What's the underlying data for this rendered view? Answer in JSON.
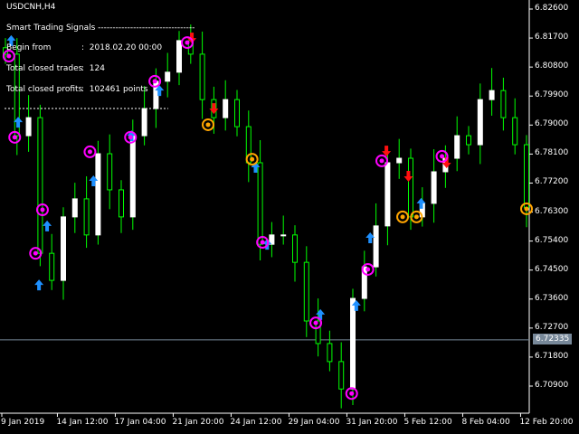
{
  "symbol_label": "USDCNH,H4",
  "panel": {
    "title": "Smart Trading Signals ---------------------------------",
    "rows": [
      {
        "label": "Begin from",
        "value": "2018.02.20 00:00"
      },
      {
        "label": "Total closed trades",
        "value": "124"
      },
      {
        "label": "Total closed profits",
        "value": "102461 points"
      }
    ]
  },
  "colors": {
    "wick": "#00ff00",
    "bull": "#ffffff",
    "bear": "#000000",
    "up_arrow": "#1e90ff",
    "down_arrow": "#ff1010",
    "open_circle": "#ff00ff",
    "close_circle": "#ffa500",
    "grid": "#ffffff",
    "current_line": "#778899"
  },
  "chart_data": {
    "type": "candlestick",
    "title": "USDCNH,H4",
    "ylim": [
      6.709,
      6.826
    ],
    "y_ticks": [
      "6.82600",
      "6.81700",
      "6.80800",
      "6.79900",
      "6.79000",
      "6.78100",
      "6.77200",
      "6.76300",
      "6.75400",
      "6.74500",
      "6.73600",
      "6.72700",
      "6.71800",
      "6.70900"
    ],
    "x_ticks": [
      {
        "label": "9 Jan 2019",
        "i": 0
      },
      {
        "label": "14 Jan 12:00",
        "i": 4.8
      },
      {
        "label": "17 Jan 04:00",
        "i": 9.8
      },
      {
        "label": "21 Jan 20:00",
        "i": 14.8
      },
      {
        "label": "24 Jan 12:00",
        "i": 19.8
      },
      {
        "label": "29 Jan 04:00",
        "i": 24.8
      },
      {
        "label": "31 Jan 20:00",
        "i": 29.8
      },
      {
        "label": "5 Feb 12:00",
        "i": 34.8
      },
      {
        "label": "8 Feb 04:00",
        "i": 39.8
      },
      {
        "label": "12 Feb 20:00",
        "i": 44.8
      }
    ],
    "current_price": "6.72335",
    "current_price_value": 6.72335,
    "closes": [
      6.812,
      6.7867,
      6.7923,
      6.7502,
      6.7418,
      6.7615,
      6.7671,
      6.7559,
      6.7811,
      6.7699,
      6.7615,
      6.7867,
      6.7951,
      6.8036,
      6.8064,
      6.8162,
      6.812,
      6.7979,
      6.7923,
      6.7979,
      6.7895,
      6.7783,
      6.753,
      6.7559,
      6.7559,
      6.7474,
      6.7292,
      6.7222,
      6.7166,
      6.7081,
      6.7362,
      6.746,
      6.7587,
      6.7783,
      6.7797,
      6.7615,
      6.7657,
      6.7755,
      6.7797,
      6.7867,
      6.7839,
      6.7979,
      6.8007,
      6.7923,
      6.7839,
      6.7643
    ],
    "signals": [
      {
        "type": "buy-arrow",
        "i": 0.5,
        "price": 6.8162
      },
      {
        "type": "buy-arrow",
        "i": 1.1,
        "price": 6.7909
      },
      {
        "type": "buy-arrow",
        "i": 2.9,
        "price": 6.7404
      },
      {
        "type": "buy-arrow",
        "i": 3.6,
        "price": 6.7587
      },
      {
        "type": "buy-arrow",
        "i": 7.6,
        "price": 6.7727
      },
      {
        "type": "buy-arrow",
        "i": 10.9,
        "price": 6.7867
      },
      {
        "type": "buy-arrow",
        "i": 13.3,
        "price": 6.8007
      },
      {
        "type": "buy-arrow",
        "i": 21.6,
        "price": 6.7769
      },
      {
        "type": "buy-arrow",
        "i": 22.6,
        "price": 6.753
      },
      {
        "type": "buy-arrow",
        "i": 27.2,
        "price": 6.7312
      },
      {
        "type": "buy-arrow",
        "i": 30.3,
        "price": 6.734
      },
      {
        "type": "buy-arrow",
        "i": 31.5,
        "price": 6.755
      },
      {
        "type": "buy-arrow",
        "i": 35.9,
        "price": 6.7657
      },
      {
        "type": "sell-arrow",
        "i": 16.1,
        "price": 6.817
      },
      {
        "type": "sell-arrow",
        "i": 18.0,
        "price": 6.7951
      },
      {
        "type": "sell-arrow",
        "i": 32.9,
        "price": 6.7819
      },
      {
        "type": "sell-arrow",
        "i": 34.8,
        "price": 6.7741
      },
      {
        "type": "sell-arrow",
        "i": 38.1,
        "price": 6.7783
      },
      {
        "type": "open-circle",
        "i": 0.3,
        "price": 6.8114
      },
      {
        "type": "open-circle",
        "i": 0.8,
        "price": 6.7862
      },
      {
        "type": "open-circle",
        "i": 2.6,
        "price": 6.7502
      },
      {
        "type": "open-circle",
        "i": 3.2,
        "price": 6.7637
      },
      {
        "type": "open-circle",
        "i": 7.3,
        "price": 6.7817
      },
      {
        "type": "open-circle",
        "i": 10.8,
        "price": 6.7862
      },
      {
        "type": "open-circle",
        "i": 12.9,
        "price": 6.8036
      },
      {
        "type": "open-circle",
        "i": 15.7,
        "price": 6.8156
      },
      {
        "type": "open-circle",
        "i": 22.2,
        "price": 6.7536
      },
      {
        "type": "open-circle",
        "i": 26.8,
        "price": 6.7286
      },
      {
        "type": "open-circle",
        "i": 29.9,
        "price": 6.7067
      },
      {
        "type": "open-circle",
        "i": 31.3,
        "price": 6.7452
      },
      {
        "type": "open-circle",
        "i": 32.5,
        "price": 6.7789
      },
      {
        "type": "open-circle",
        "i": 37.7,
        "price": 6.7803
      },
      {
        "type": "close-circle",
        "i": 17.5,
        "price": 6.7901
      },
      {
        "type": "close-circle",
        "i": 21.3,
        "price": 6.7794
      },
      {
        "type": "close-circle",
        "i": 34.3,
        "price": 6.7615
      },
      {
        "type": "close-circle",
        "i": 35.5,
        "price": 6.7615
      },
      {
        "type": "close-circle",
        "i": 45.0,
        "price": 6.764
      }
    ]
  }
}
